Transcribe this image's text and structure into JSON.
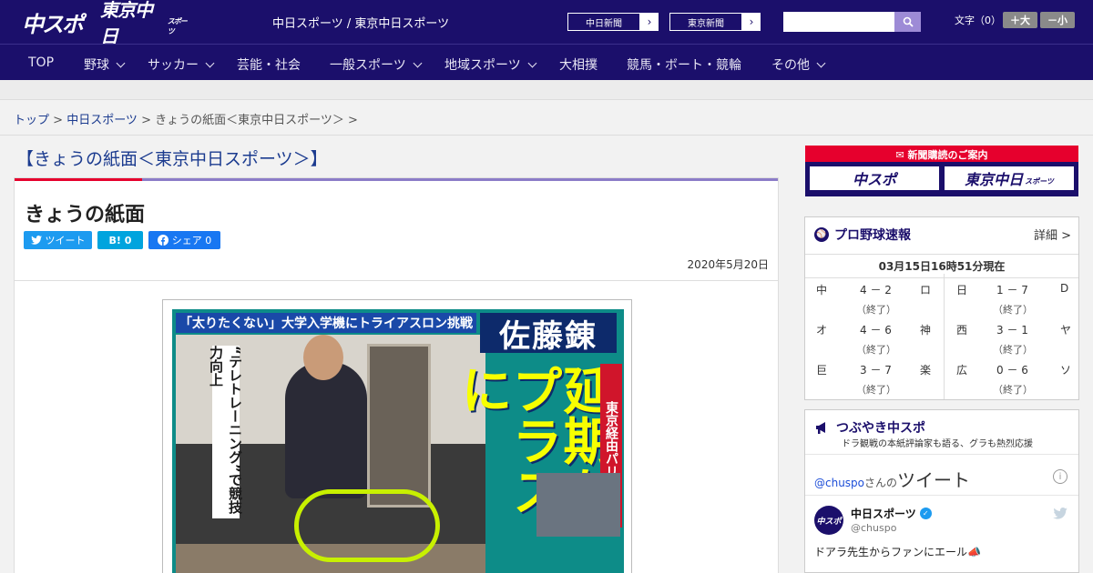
{
  "header": {
    "logo_chuspo": "中スポ",
    "logo_tokyo": "東京中日",
    "logo_tokyo_small": "スポーツ",
    "site_title": "中日スポーツ / 東京中日スポーツ",
    "paper_links": [
      {
        "label": "中日新聞",
        "arrow": "›"
      },
      {
        "label": "東京新聞",
        "arrow": "›"
      }
    ],
    "search_placeholder": "",
    "font_size_label": "文字（0）",
    "font_larger": "＋大",
    "font_smaller": "－小"
  },
  "nav": {
    "items": [
      {
        "label": "TOP",
        "has_menu": false
      },
      {
        "label": "野球",
        "has_menu": true
      },
      {
        "label": "サッカー",
        "has_menu": true
      },
      {
        "label": "芸能・社会",
        "has_menu": false
      },
      {
        "label": "一般スポーツ",
        "has_menu": true
      },
      {
        "label": "地域スポーツ",
        "has_menu": true
      },
      {
        "label": "大相撲",
        "has_menu": false
      },
      {
        "label": "競馬・ボート・競輪",
        "has_menu": false
      },
      {
        "label": "その他",
        "has_menu": true
      }
    ]
  },
  "breadcrumb": {
    "top": "トップ",
    "sep1": " > ",
    "chunichi": "中日スポーツ",
    "sep2": " > ",
    "current": "きょうの紙面＜東京中日スポーツ＞",
    "sep3": " >"
  },
  "page": {
    "heading": "【きょうの紙面＜東京中日スポーツ＞】",
    "article_title": "きょうの紙面",
    "share_tweet": "ツイート",
    "share_hatena": "B! 0",
    "share_facebook": "シェア 0",
    "date": "2020年5月20日"
  },
  "newspaper": {
    "banner": "「太りたくない」大学入学機にトライアスロン挑戦",
    "name": "佐藤錬",
    "side_text": "“テレトレーニング”で競技力向上",
    "headline": "延期をプラスに",
    "right_strip": "東京経由パリへ"
  },
  "sidebar": {
    "subscribe_title": "新聞購読のご案内",
    "subscribe_chuspo": "中スポ",
    "subscribe_tokyo": "東京中日",
    "subscribe_tokyo_small": "スポーツ",
    "baseball": {
      "title": "プロ野球速報",
      "more": "詳細 >",
      "updated": "03月15日16時51分現在",
      "games": [
        {
          "home": "中",
          "score": "4 － 2",
          "away": "ロ",
          "status": "（終了）"
        },
        {
          "home": "日",
          "score": "1 － 7",
          "away": "D",
          "status": "（終了）"
        },
        {
          "home": "オ",
          "score": "4 － 6",
          "away": "神",
          "status": "（終了）"
        },
        {
          "home": "西",
          "score": "3 － 1",
          "away": "ヤ",
          "status": "（終了）"
        },
        {
          "home": "巨",
          "score": "3 － 7",
          "away": "楽",
          "status": "（終了）"
        },
        {
          "home": "広",
          "score": "0 － 6",
          "away": "ソ",
          "status": "（終了）"
        }
      ]
    },
    "twitter": {
      "title": "つぶやき中スポ",
      "subtitle": "ドラ観戦の本紙評論家も語る、グラも熱烈応援",
      "handle": "@chuspo",
      "handle_suffix": "さんの",
      "tweets_label": "ツイート",
      "account_name": "中日スポーツ",
      "account_handle": "@chuspo",
      "avatar_text": "中スポ",
      "tweet_text": "ドアラ先生からファンにエール📣"
    }
  }
}
